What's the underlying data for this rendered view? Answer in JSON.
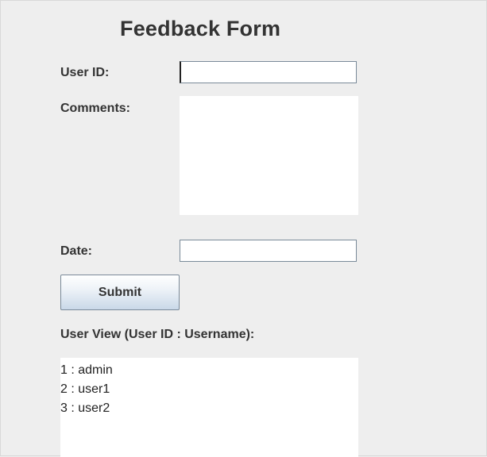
{
  "form": {
    "title": "Feedback Form",
    "user_id_label": "User ID:",
    "user_id_value": "",
    "comments_label": "Comments:",
    "comments_value": "",
    "date_label": "Date:",
    "date_value": "",
    "submit_label": "Submit"
  },
  "user_view": {
    "label": "User View (User ID : Username):",
    "items": [
      "1 : admin",
      "2 : user1",
      "3 : user2"
    ]
  },
  "colors": {
    "background": "#eeeeee",
    "field_background": "#ffffff",
    "field_border": "#7a8a99",
    "button_gradient_bottom": "#c9d8e8",
    "text": "#333333"
  }
}
